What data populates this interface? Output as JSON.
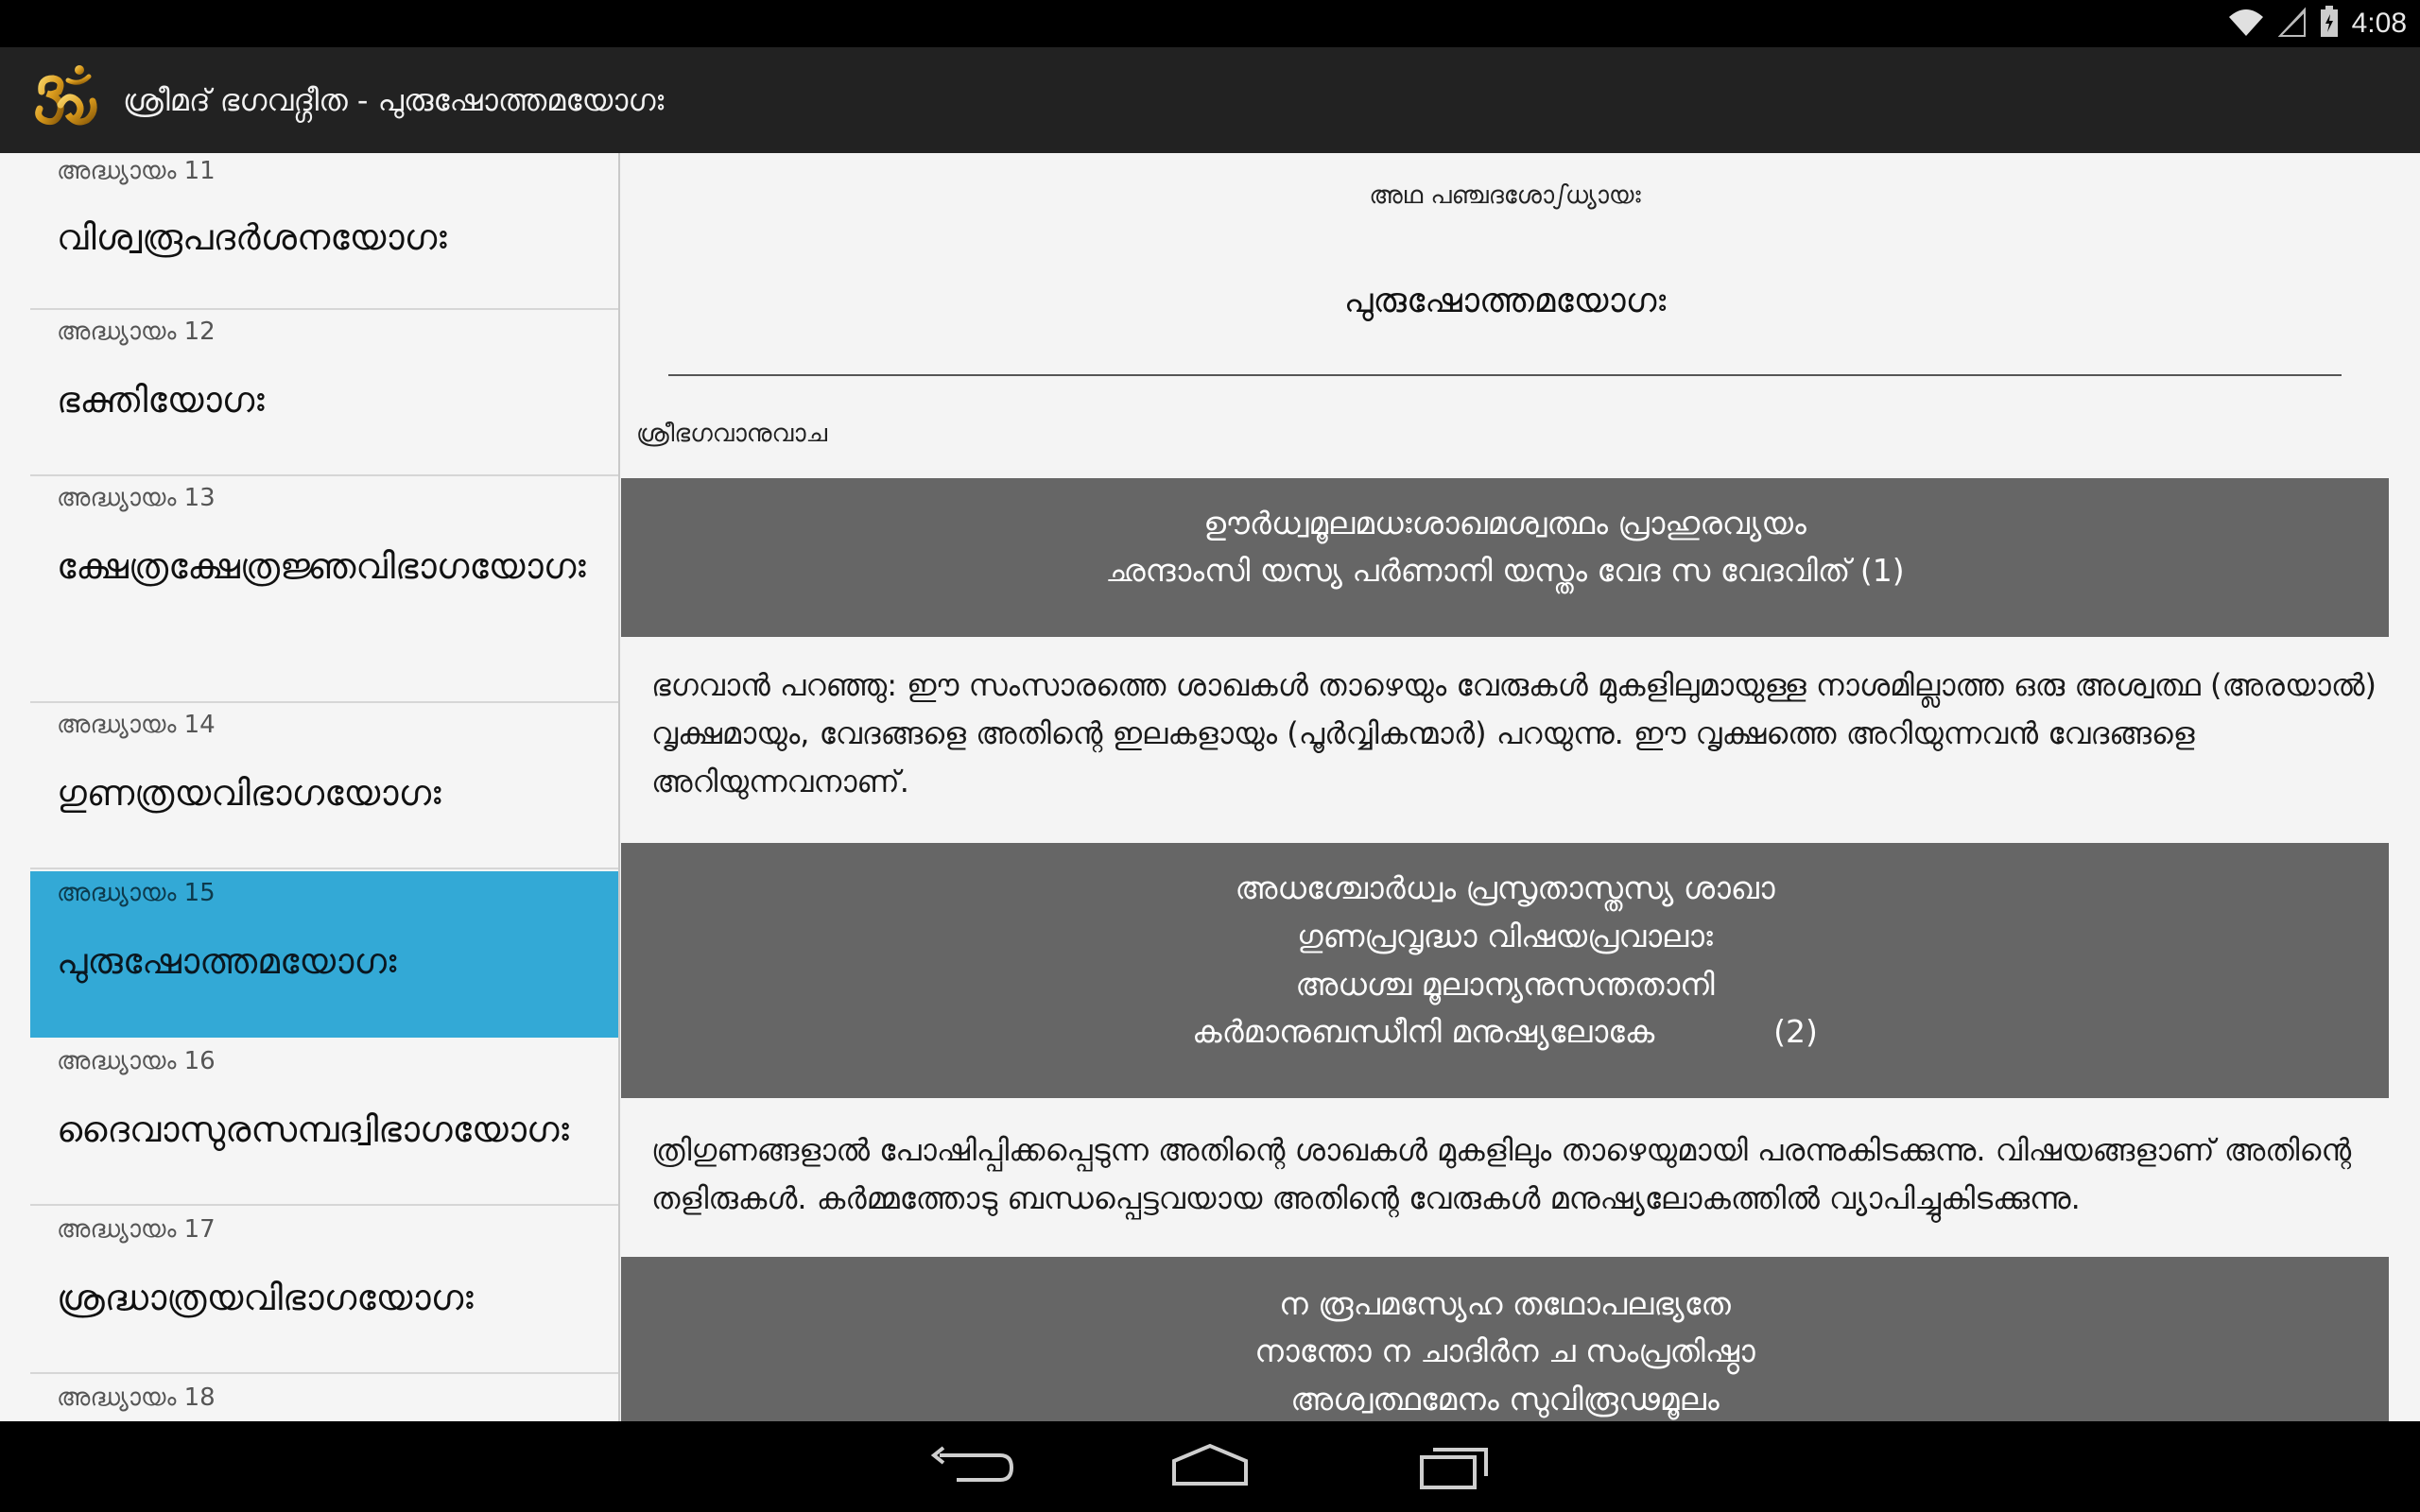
{
  "status_bar": {
    "time": "4:08",
    "icons": [
      "wifi-icon",
      "signal-icon",
      "battery-icon"
    ]
  },
  "action_bar": {
    "icon": "om-icon",
    "title": "ശ്രീമദ് ഭഗവദ്ഗീത - പുരുഷോത്തമയോഗഃ"
  },
  "sidebar": {
    "items": [
      {
        "number": "അദ്ധ്യായം 11",
        "name": "വിശ്വരൂപദർശനയോഗഃ"
      },
      {
        "number": "അദ്ധ്യായം 12",
        "name": "ഭക്തിയോഗഃ"
      },
      {
        "number": "അദ്ധ്യായം 13",
        "name": "ക്ഷേത്രക്ഷേത്രജ്ഞവിഭാഗയോഗഃ"
      },
      {
        "number": "അദ്ധ്യായം 14",
        "name": "ഗുണത്രയവിഭാഗയോഗഃ"
      },
      {
        "number": "അദ്ധ്യായം 15",
        "name": "പുരുഷോത്തമയോഗഃ"
      },
      {
        "number": "അദ്ധ്യായം 16",
        "name": "ദൈവാസുരസമ്പദ്വിഭാഗയോഗഃ"
      },
      {
        "number": "അദ്ധ്യായം 17",
        "name": "ശ്രദ്ധാത്രയവിഭാഗയോഗഃ"
      },
      {
        "number": "അദ്ധ്യായം 18",
        "name": ""
      }
    ],
    "selected_index": 4
  },
  "content": {
    "subtitle": "അഥ പഞ്ചദശോഽധ്യായഃ",
    "title": "പുരുഷോത്തമയോഗഃ",
    "speaker": "ശ്രീഭഗവാനുവാച",
    "verses": [
      {
        "lines": [
          "ഊർധ്വമൂലമധഃശാഖമശ്വത്ഥം പ്രാഹുരവ്യയം",
          "ഛന്ദാംസി യസ്യ പർണാനി യസ്തം വേദ സ വേദവിത്  (1)"
        ],
        "meaning": "ഭഗവാൻ പറഞ്ഞു: ഈ സംസാരത്തെ ശാഖകൾ താഴെയും വേരുകൾ മുകളിലുമായുള്ള നാശമില്ലാത്ത ഒരു അശ്വത്ഥ (അരയാൽ) വൃക്ഷമായും, വേദങ്ങളെ അതിന്റെ ഇലകളായും (പൂർവ്വികന്മാർ) പറയുന്നു. ഈ വൃക്ഷത്തെ അറിയുന്നവൻ വേദങ്ങളെ അറിയുന്നവനാണ്."
      },
      {
        "lines": [
          "അധശ്ചോർധ്വം പ്രസൃതാസ്തസ്യ ശാഖാ",
          "ഗുണപ്രവൃദ്ധാ വിഷയപ്രവാലാഃ",
          "അധശ്ച മൂലാന്യനുസന്തതാനി",
          "കർമാനുബന്ധീനി മനുഷ്യലോകേ            (2)"
        ],
        "meaning": "ത്രിഗുണങ്ങളാൽ പോഷിപ്പിക്കപ്പെടുന്ന അതിന്റെ ശാഖകൾ മുകളിലും താഴെയുമായി പരന്നുകിടക്കുന്നു. വിഷയങ്ങളാണ് അതിന്റെ തളിരുകൾ. കർമ്മത്തോടു ബന്ധപ്പെട്ടവയായ അതിന്റെ വേരുകൾ മനുഷ്യലോകത്തിൽ വ്യാപിച്ചുകിടക്കുന്നു."
      },
      {
        "lines": [
          "ന രൂപമസ്യേഹ തഥോപലഭ്യതേ",
          "നാന്തോ ന ചാദിർന ച സംപ്രതിഷ്ഠാ",
          "അശ്വത്ഥമേനം സുവിരൂഢമൂലം"
        ],
        "meaning": ""
      }
    ]
  },
  "nav_bar": {
    "buttons": [
      "back-icon",
      "home-icon",
      "recents-icon"
    ]
  },
  "colors": {
    "action_bar": "#222222",
    "selected_item": "#33a9d6",
    "verse_background": "#666666"
  }
}
